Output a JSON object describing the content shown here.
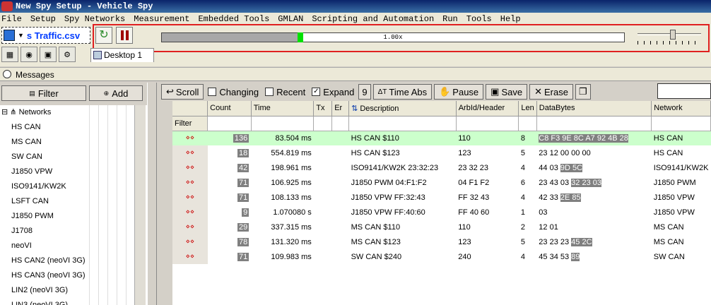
{
  "window": {
    "title": "New Spy Setup - Vehicle Spy"
  },
  "menu": [
    "File",
    "Setup",
    "Spy Networks",
    "Measurement",
    "Embedded Tools",
    "GMLAN",
    "Scripting and Automation",
    "Run",
    "Tools",
    "Help"
  ],
  "toolbar": {
    "file_name": "s Traffic.csv",
    "speed_label": "1.00x",
    "playback_position": 0.3,
    "speed_slider_position": 0.55
  },
  "tabs": {
    "desktop": "Desktop 1"
  },
  "messages_title": "Messages",
  "left": {
    "filter_label": "Filter",
    "add_label": "Add",
    "tree_root": "Networks",
    "networks": [
      "HS CAN",
      "MS CAN",
      "SW CAN",
      "J1850 VPW",
      "ISO9141/KW2K",
      "LSFT CAN",
      "J1850 PWM",
      "J1708",
      "neoVI",
      "HS CAN2 (neoVI 3G)",
      "HS CAN3 (neoVI 3G)",
      "LIN2 (neoVI 3G)",
      "LIN3 (neoVI 3G)"
    ]
  },
  "msg_toolbar": {
    "scroll": "Scroll",
    "changing": "Changing",
    "recent": "Recent",
    "expand": "Expand",
    "expand_count": "9",
    "time_abs": "Time Abs",
    "pause": "Pause",
    "save": "Save",
    "erase": "Erase"
  },
  "columns": {
    "count": "Count",
    "time": "Time",
    "tx": "Tx",
    "er": "Er",
    "description": "Description",
    "arbid": "ArbId/Header",
    "len": "Len",
    "databytes": "DataBytes",
    "network": "Network"
  },
  "filter_label": "Filter",
  "rows": [
    {
      "count": "136",
      "time": "83.504 ms",
      "description": "HS CAN $110",
      "arbid": "110",
      "len": "8",
      "plain": "",
      "hl": "C8 F3 9E 8C A7 92 4B 28",
      "network": "HS CAN",
      "selected": true
    },
    {
      "count": "18",
      "time": "554.819 ms",
      "description": "HS CAN $123",
      "arbid": "123",
      "len": "5",
      "plain": "23 12 00 00 00",
      "hl": "",
      "network": "HS CAN",
      "selected": false
    },
    {
      "count": "42",
      "time": "198.961 ms",
      "description": "ISO9141/KW2K 23:32:23",
      "arbid": "23 32 23",
      "len": "4",
      "plain": "44 03 ",
      "hl": "9D 5C",
      "network": "ISO9141/KW2K",
      "selected": false
    },
    {
      "count": "71",
      "time": "106.925 ms",
      "description": "J1850 PWM 04:F1:F2",
      "arbid": "04 F1 F2",
      "len": "6",
      "plain": "23 43 03 ",
      "hl": "32 23 03",
      "network": "J1850 PWM",
      "selected": false
    },
    {
      "count": "71",
      "time": "108.133 ms",
      "description": "J1850 VPW FF:32:43",
      "arbid": "FF 32 43",
      "len": "4",
      "plain": "42 33 ",
      "hl": "2E 85",
      "network": "J1850 VPW",
      "selected": false
    },
    {
      "count": "9",
      "time": "1.070080 s",
      "description": "J1850 VPW FF:40:60",
      "arbid": "FF 40 60",
      "len": "1",
      "plain": "03",
      "hl": "",
      "network": "J1850 VPW",
      "selected": false
    },
    {
      "count": "29",
      "time": "337.315 ms",
      "description": "MS CAN $110",
      "arbid": "110",
      "len": "2",
      "plain": "12 01",
      "hl": "",
      "network": "MS CAN",
      "selected": false
    },
    {
      "count": "78",
      "time": "131.320 ms",
      "description": "MS CAN $123",
      "arbid": "123",
      "len": "5",
      "plain": "23 23 23 ",
      "hl": "45 2C",
      "network": "MS CAN",
      "selected": false
    },
    {
      "count": "71",
      "time": "109.983 ms",
      "description": "SW CAN $240",
      "arbid": "240",
      "len": "4",
      "plain": "45 34 53 ",
      "hl": "89",
      "network": "SW CAN",
      "selected": false
    }
  ]
}
